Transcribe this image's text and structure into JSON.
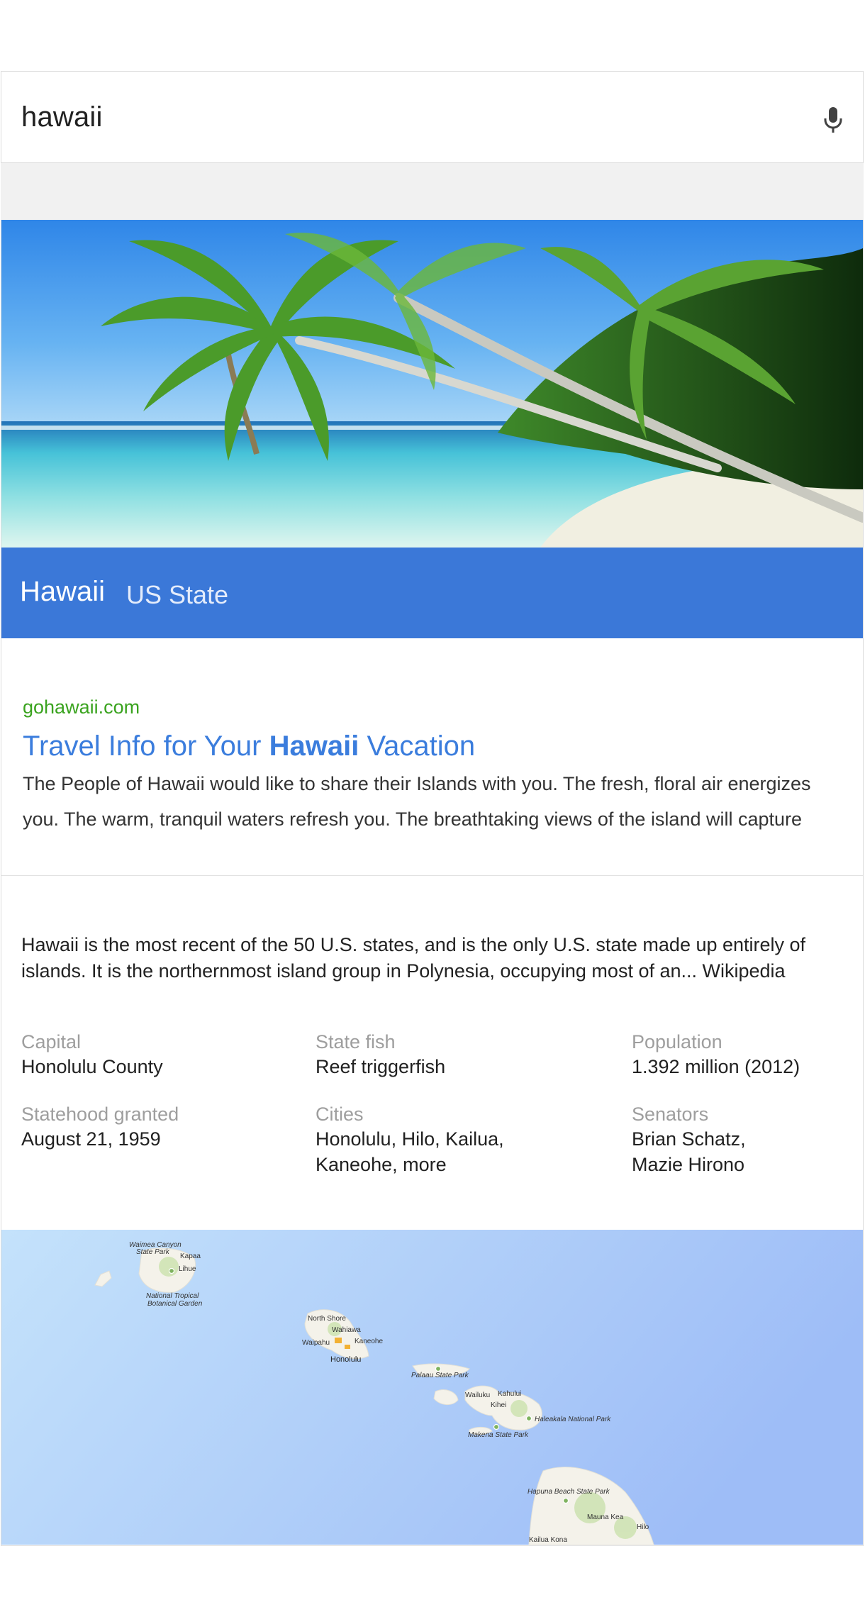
{
  "search": {
    "query": "hawaii",
    "mic_icon": "microphone-icon"
  },
  "entity": {
    "name": "Hawaii",
    "type": "US State",
    "colors": {
      "title_bar": "#3b78d8"
    }
  },
  "result": {
    "url": "gohawaii.com",
    "title_prefix": "Travel Info for Your ",
    "title_bold": "Hawaii",
    "title_suffix": " Vacation",
    "snippet": "The People of Hawaii would like to share their Islands with you. The fresh, floral air energizes you. The warm, tranquil waters refresh you. The breathtaking views of the island will capture"
  },
  "knowledge": {
    "description": "Hawaii is the most recent of the 50 U.S. states, and is the only U.S. state made up entirely of islands. It is the northernmost island group in Polynesia, occupying most of an... Wikipedia",
    "facts": [
      {
        "label": "Capital",
        "value": "Honolulu County"
      },
      {
        "label": "State fish",
        "value": "Reef triggerfish"
      },
      {
        "label": "Population",
        "value": "1.392 million (2012)"
      },
      {
        "label": "Statehood granted",
        "value": "August 21, 1959"
      },
      {
        "label": "Cities",
        "value_line1": "Honolulu, Hilo, Kailua,",
        "value_line2": "Kaneohe, more"
      },
      {
        "label": "Senators",
        "value_line1": "Brian Schatz,",
        "value_line2": "Mazie Hirono"
      }
    ]
  },
  "map": {
    "labels": {
      "waimea": "Waimea Canyon",
      "waimea2": "State Park",
      "kapaa": "Kapaa",
      "lihue": "Lihue",
      "ntbg1": "National Tropical",
      "ntbg2": "Botanical Garden",
      "north_shore": "North Shore",
      "wahiawa": "Wahiawa",
      "waipahu": "Waipahu",
      "kaneohe": "Kaneohe",
      "honolulu": "Honolulu",
      "palaau": "Palaau State Park",
      "wailuku": "Wailuku",
      "kahului": "Kahului",
      "kihei": "Kihei",
      "haleakala": "Haleakala National Park",
      "makena": "Makena State Park",
      "hapuna": "Hapuna Beach State Park",
      "mauna_kea": "Mauna Kea",
      "hilo": "Hilo",
      "kailua_kona": "Kailua Kona"
    }
  }
}
